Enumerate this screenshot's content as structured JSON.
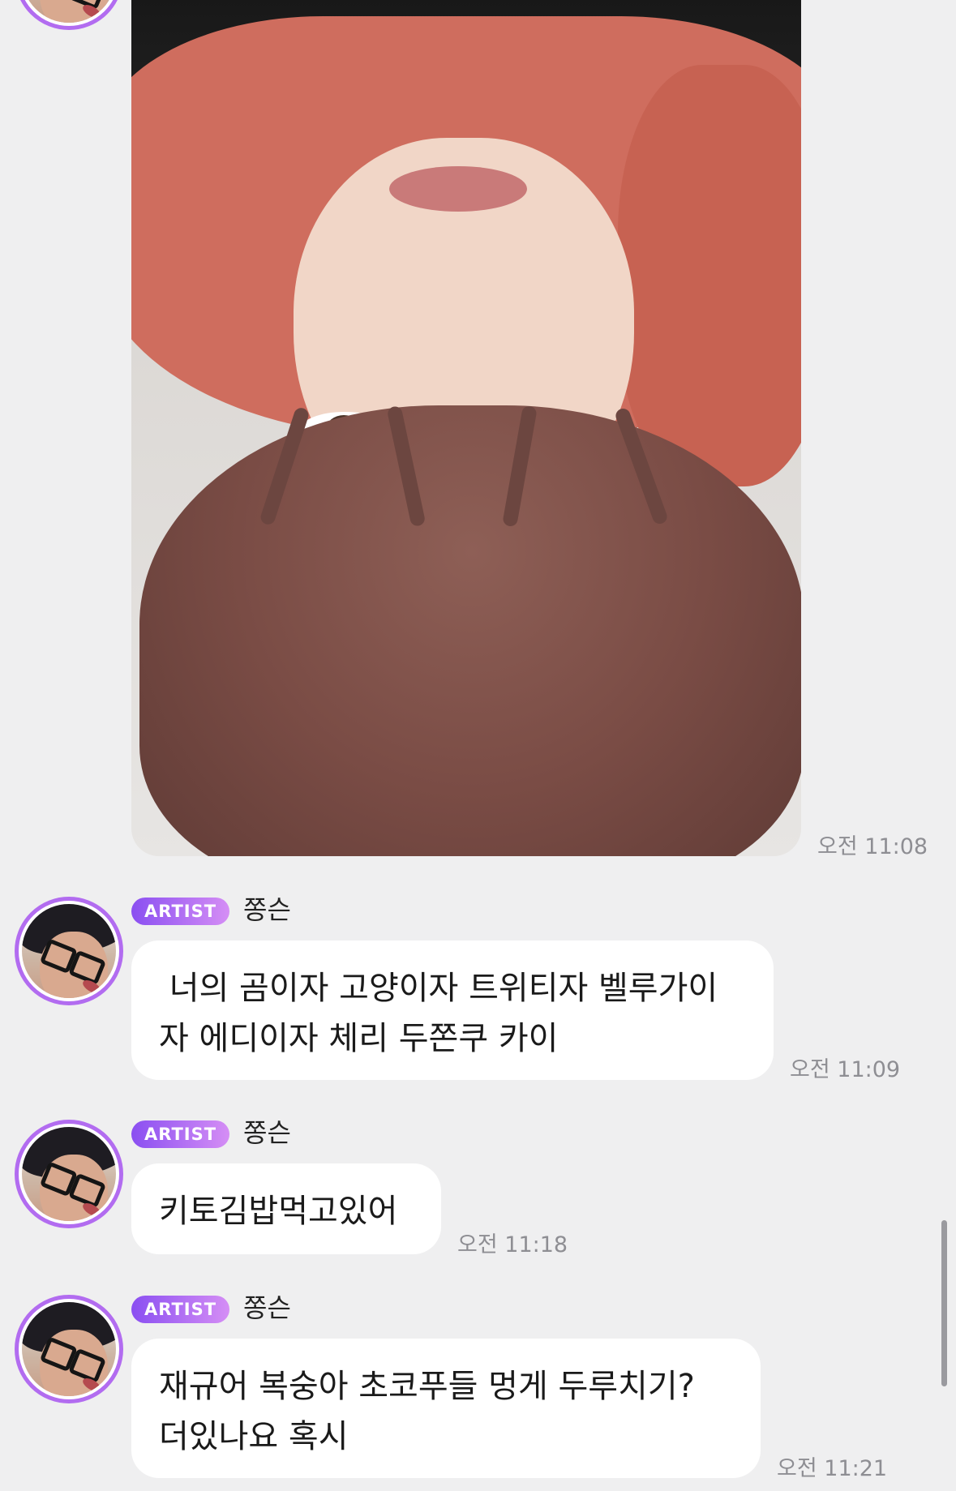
{
  "messages": [
    {
      "type": "photo",
      "time": "오전 11:08"
    },
    {
      "type": "text",
      "badge": "ARTIST",
      "sender": "쫑슨",
      "text": " 너의 곰이자 고양이자 트위티자 벨루가이\n자 에디이자 체리 두쫀쿠 카이",
      "time": "오전 11:09"
    },
    {
      "type": "text",
      "badge": "ARTIST",
      "sender": "쫑슨",
      "text": "키토김밥먹고있어",
      "time": "오전 11:18"
    },
    {
      "type": "text",
      "badge": "ARTIST",
      "sender": "쫑슨",
      "text": "재규어 복숭아 초코푸들 멍게 두루치기?\n더있나요 혹시",
      "time": "오전 11:21"
    }
  ],
  "colors": {
    "background": "#efeff0",
    "bubble": "#ffffff",
    "badge_start": "#8a4ff1",
    "badge_end": "#d58ef5",
    "avatar_ring": "#b26cf0",
    "time_text": "#8e8e93"
  },
  "icons": [
    "artist-avatar",
    "photo-selfie"
  ]
}
